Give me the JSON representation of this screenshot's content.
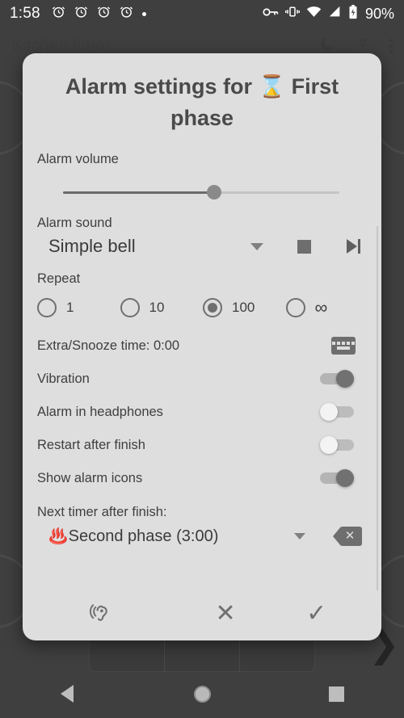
{
  "status_bar": {
    "time": "1:58",
    "alarm_icon_count": 4,
    "icons": [
      "alarm-icon",
      "alarm-icon",
      "alarm-icon",
      "alarm-icon",
      "notification-dot",
      "vpn-key-icon",
      "vibrate-icon",
      "wifi-icon",
      "cellular-signal-icon",
      "battery-charging-icon"
    ],
    "battery_percent": "90%"
  },
  "app_bar": {
    "title": "Kitchen timer",
    "icons": [
      "moon-icon",
      "help-icon",
      "overflow-menu-icon"
    ]
  },
  "dialog": {
    "title": "Alarm settings for ⌛ First phase",
    "volume": {
      "label": "Alarm volume",
      "value_percent": 50
    },
    "sound": {
      "label": "Alarm sound",
      "selected": "Simple bell",
      "stop_label": "stop-button",
      "next_label": "skip-next-button"
    },
    "repeat": {
      "label": "Repeat",
      "options": [
        {
          "label": "1",
          "selected": false
        },
        {
          "label": "10",
          "selected": false
        },
        {
          "label": "100",
          "selected": true
        },
        {
          "label": "∞",
          "selected": false
        }
      ]
    },
    "snooze": {
      "label": "Extra/Snooze time: 0:00",
      "keyboard_button": "keyboard-icon"
    },
    "toggles": [
      {
        "label": "Vibration",
        "on": true
      },
      {
        "label": "Alarm in headphones",
        "on": false
      },
      {
        "label": "Restart after finish",
        "on": false
      },
      {
        "label": "Show alarm icons",
        "on": true
      }
    ],
    "next_timer": {
      "label": "Next timer after finish:",
      "emoji": "♨️",
      "selected": "Second phase (3:00)",
      "clear_button": "backspace-clear-button"
    },
    "actions": {
      "test_sound": "hearing-icon",
      "cancel": "✕",
      "confirm": "✓"
    }
  },
  "nav_bar": {
    "back": "back-button",
    "home": "home-button",
    "recents": "recents-button"
  },
  "colors": {
    "dialog_bg": "#dedede",
    "backdrop": "#4d4d4d",
    "accent": "#6f6f6f",
    "text": "#3f3f3f"
  }
}
